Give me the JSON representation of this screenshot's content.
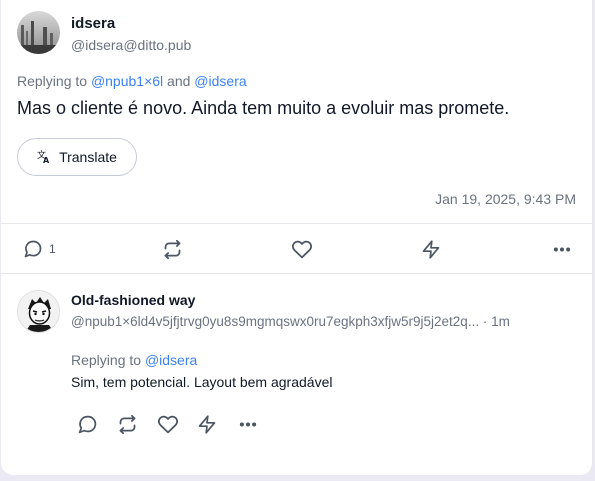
{
  "post": {
    "author_name": "idsera",
    "author_handle": "@idsera@ditto.pub",
    "replying_prefix": "Replying to",
    "replying_to_1": "@npub1×6l",
    "replying_and": "and",
    "replying_to_2": "@idsera",
    "content": "Mas o cliente é novo. Ainda tem muito a evoluir mas promete.",
    "translate_label": "Translate",
    "date": "Jan 19, 2025, 9:43 PM",
    "reply_count": "1",
    "icons": [
      "comment-icon",
      "repost-icon",
      "heart-icon",
      "zap-icon",
      "more-icon"
    ]
  },
  "reply": {
    "author_name": "Old-fashioned way",
    "author_handle": "@npub1×6ld4v5jfjtrvg0yu8s9mgmqswx0ru7egkph3xfjw5r9j5j2et2q...",
    "time": "· 1m",
    "replying_prefix": "Replying to",
    "replying_to": "@idsera",
    "content": "Sim, tem potencial. Layout bem agradável",
    "icons": [
      "comment-icon",
      "repost-icon",
      "heart-icon",
      "zap-icon",
      "more-icon"
    ]
  },
  "colors": {
    "link": "#3b82f6",
    "muted": "#6b7280",
    "background": "#ebe9f4"
  }
}
